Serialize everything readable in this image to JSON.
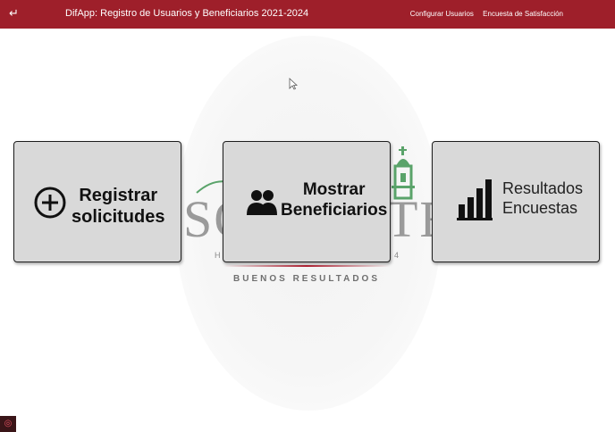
{
  "header": {
    "back_icon_glyph": "↵",
    "title": "DifApp: Registro de Usuarios y Beneficiarios 2021-2024",
    "nav": [
      {
        "label": "Configurar Usuarios"
      },
      {
        "label": "Encuesta de Satisfacción"
      }
    ],
    "background_color": "#9e1f2a"
  },
  "background_logo": {
    "text_left": "SO",
    "text_right": "TE",
    "left_letter": "H",
    "right_digit": "4",
    "tagline": "BUENOS RESULTADOS",
    "accent_color": "#b22234",
    "tower_color": "#5aa36a"
  },
  "tiles": [
    {
      "line1": "Registrar",
      "line2": "solicitudes",
      "icon": "plus-circle-icon"
    },
    {
      "line1": "Mostrar",
      "line2": "Beneficiarios",
      "icon": "users-icon"
    },
    {
      "line1": "Resultados",
      "line2": "Encuestas",
      "icon": "bar-chart-icon"
    }
  ],
  "taskbar": {
    "corner_glyph": "◎"
  }
}
